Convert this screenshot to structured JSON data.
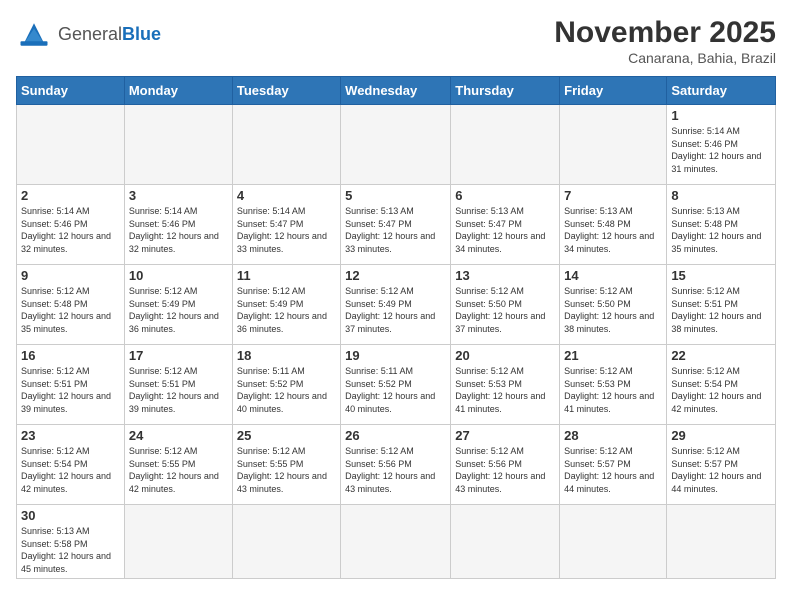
{
  "header": {
    "logo_general": "General",
    "logo_blue": "Blue",
    "title": "November 2025",
    "subtitle": "Canarana, Bahia, Brazil"
  },
  "days_of_week": [
    "Sunday",
    "Monday",
    "Tuesday",
    "Wednesday",
    "Thursday",
    "Friday",
    "Saturday"
  ],
  "weeks": [
    [
      {
        "day": "",
        "empty": true
      },
      {
        "day": "",
        "empty": true
      },
      {
        "day": "",
        "empty": true
      },
      {
        "day": "",
        "empty": true
      },
      {
        "day": "",
        "empty": true
      },
      {
        "day": "",
        "empty": true
      },
      {
        "day": "1",
        "sunrise": "Sunrise: 5:14 AM",
        "sunset": "Sunset: 5:46 PM",
        "daylight": "Daylight: 12 hours and 31 minutes."
      }
    ],
    [
      {
        "day": "2",
        "sunrise": "Sunrise: 5:14 AM",
        "sunset": "Sunset: 5:46 PM",
        "daylight": "Daylight: 12 hours and 32 minutes."
      },
      {
        "day": "3",
        "sunrise": "Sunrise: 5:14 AM",
        "sunset": "Sunset: 5:46 PM",
        "daylight": "Daylight: 12 hours and 32 minutes."
      },
      {
        "day": "4",
        "sunrise": "Sunrise: 5:14 AM",
        "sunset": "Sunset: 5:47 PM",
        "daylight": "Daylight: 12 hours and 33 minutes."
      },
      {
        "day": "5",
        "sunrise": "Sunrise: 5:13 AM",
        "sunset": "Sunset: 5:47 PM",
        "daylight": "Daylight: 12 hours and 33 minutes."
      },
      {
        "day": "6",
        "sunrise": "Sunrise: 5:13 AM",
        "sunset": "Sunset: 5:47 PM",
        "daylight": "Daylight: 12 hours and 34 minutes."
      },
      {
        "day": "7",
        "sunrise": "Sunrise: 5:13 AM",
        "sunset": "Sunset: 5:48 PM",
        "daylight": "Daylight: 12 hours and 34 minutes."
      },
      {
        "day": "8",
        "sunrise": "Sunrise: 5:13 AM",
        "sunset": "Sunset: 5:48 PM",
        "daylight": "Daylight: 12 hours and 35 minutes."
      }
    ],
    [
      {
        "day": "9",
        "sunrise": "Sunrise: 5:12 AM",
        "sunset": "Sunset: 5:48 PM",
        "daylight": "Daylight: 12 hours and 35 minutes."
      },
      {
        "day": "10",
        "sunrise": "Sunrise: 5:12 AM",
        "sunset": "Sunset: 5:49 PM",
        "daylight": "Daylight: 12 hours and 36 minutes."
      },
      {
        "day": "11",
        "sunrise": "Sunrise: 5:12 AM",
        "sunset": "Sunset: 5:49 PM",
        "daylight": "Daylight: 12 hours and 36 minutes."
      },
      {
        "day": "12",
        "sunrise": "Sunrise: 5:12 AM",
        "sunset": "Sunset: 5:49 PM",
        "daylight": "Daylight: 12 hours and 37 minutes."
      },
      {
        "day": "13",
        "sunrise": "Sunrise: 5:12 AM",
        "sunset": "Sunset: 5:50 PM",
        "daylight": "Daylight: 12 hours and 37 minutes."
      },
      {
        "day": "14",
        "sunrise": "Sunrise: 5:12 AM",
        "sunset": "Sunset: 5:50 PM",
        "daylight": "Daylight: 12 hours and 38 minutes."
      },
      {
        "day": "15",
        "sunrise": "Sunrise: 5:12 AM",
        "sunset": "Sunset: 5:51 PM",
        "daylight": "Daylight: 12 hours and 38 minutes."
      }
    ],
    [
      {
        "day": "16",
        "sunrise": "Sunrise: 5:12 AM",
        "sunset": "Sunset: 5:51 PM",
        "daylight": "Daylight: 12 hours and 39 minutes."
      },
      {
        "day": "17",
        "sunrise": "Sunrise: 5:12 AM",
        "sunset": "Sunset: 5:51 PM",
        "daylight": "Daylight: 12 hours and 39 minutes."
      },
      {
        "day": "18",
        "sunrise": "Sunrise: 5:11 AM",
        "sunset": "Sunset: 5:52 PM",
        "daylight": "Daylight: 12 hours and 40 minutes."
      },
      {
        "day": "19",
        "sunrise": "Sunrise: 5:11 AM",
        "sunset": "Sunset: 5:52 PM",
        "daylight": "Daylight: 12 hours and 40 minutes."
      },
      {
        "day": "20",
        "sunrise": "Sunrise: 5:12 AM",
        "sunset": "Sunset: 5:53 PM",
        "daylight": "Daylight: 12 hours and 41 minutes."
      },
      {
        "day": "21",
        "sunrise": "Sunrise: 5:12 AM",
        "sunset": "Sunset: 5:53 PM",
        "daylight": "Daylight: 12 hours and 41 minutes."
      },
      {
        "day": "22",
        "sunrise": "Sunrise: 5:12 AM",
        "sunset": "Sunset: 5:54 PM",
        "daylight": "Daylight: 12 hours and 42 minutes."
      }
    ],
    [
      {
        "day": "23",
        "sunrise": "Sunrise: 5:12 AM",
        "sunset": "Sunset: 5:54 PM",
        "daylight": "Daylight: 12 hours and 42 minutes."
      },
      {
        "day": "24",
        "sunrise": "Sunrise: 5:12 AM",
        "sunset": "Sunset: 5:55 PM",
        "daylight": "Daylight: 12 hours and 42 minutes."
      },
      {
        "day": "25",
        "sunrise": "Sunrise: 5:12 AM",
        "sunset": "Sunset: 5:55 PM",
        "daylight": "Daylight: 12 hours and 43 minutes."
      },
      {
        "day": "26",
        "sunrise": "Sunrise: 5:12 AM",
        "sunset": "Sunset: 5:56 PM",
        "daylight": "Daylight: 12 hours and 43 minutes."
      },
      {
        "day": "27",
        "sunrise": "Sunrise: 5:12 AM",
        "sunset": "Sunset: 5:56 PM",
        "daylight": "Daylight: 12 hours and 43 minutes."
      },
      {
        "day": "28",
        "sunrise": "Sunrise: 5:12 AM",
        "sunset": "Sunset: 5:57 PM",
        "daylight": "Daylight: 12 hours and 44 minutes."
      },
      {
        "day": "29",
        "sunrise": "Sunrise: 5:12 AM",
        "sunset": "Sunset: 5:57 PM",
        "daylight": "Daylight: 12 hours and 44 minutes."
      }
    ],
    [
      {
        "day": "30",
        "sunrise": "Sunrise: 5:13 AM",
        "sunset": "Sunset: 5:58 PM",
        "daylight": "Daylight: 12 hours and 45 minutes."
      },
      {
        "day": "",
        "empty": true
      },
      {
        "day": "",
        "empty": true
      },
      {
        "day": "",
        "empty": true
      },
      {
        "day": "",
        "empty": true
      },
      {
        "day": "",
        "empty": true
      },
      {
        "day": "",
        "empty": true
      }
    ]
  ]
}
